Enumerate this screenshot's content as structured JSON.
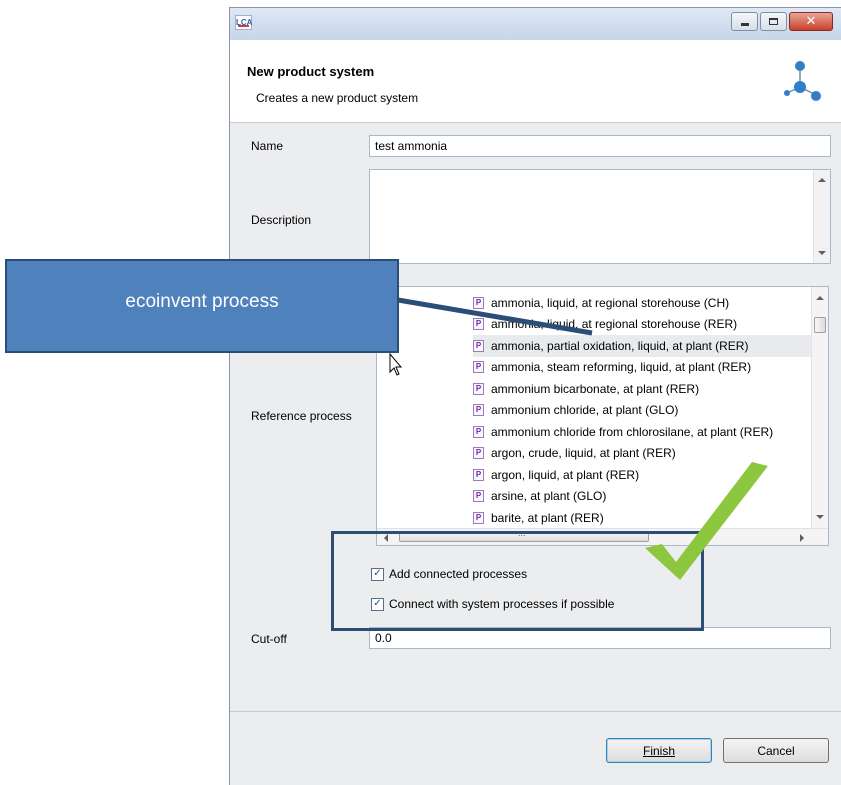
{
  "window": {
    "app_icon_text": "LCA",
    "minimize_icon": "minimize-icon",
    "maximize_icon": "maximize-icon",
    "close_icon": "close-icon"
  },
  "header": {
    "title": "New product system",
    "subtitle": "Creates a new product system",
    "icon": "product-system-icon"
  },
  "form": {
    "name_label": "Name",
    "name_value": "test ammonia",
    "description_label": "Description",
    "description_value": "",
    "reference_process_label": "Reference process",
    "processes": [
      "ammonia, liquid, at regional storehouse (CH)",
      "ammonia, liquid, at regional storehouse (RER)",
      "ammonia, partial oxidation, liquid, at plant (RER)",
      "ammonia, steam reforming, liquid, at plant (RER)",
      "ammonium bicarbonate, at plant (RER)",
      "ammonium chloride, at plant (GLO)",
      "ammonium chloride from chlorosilane, at plant (RER)",
      "argon, crude, liquid, at plant (RER)",
      "argon, liquid, at plant (RER)",
      "arsine, at plant (GLO)",
      "barite, at plant (RER)"
    ],
    "process_icon_letter": "P",
    "selected_process_index": 2,
    "hscroll_dots": "...",
    "add_connected_label": "Add connected processes",
    "add_connected_checked": true,
    "connect_system_label": "Connect with system processes if possible",
    "connect_system_checked": true,
    "cutoff_label": "Cut-off",
    "cutoff_value": "0.0"
  },
  "buttons": {
    "finish": "Finish",
    "cancel": "Cancel"
  },
  "annotation": {
    "callout_text": "ecoinvent process",
    "callout_color": "#4f81bd",
    "checkmark_color": "#8dc63f"
  }
}
